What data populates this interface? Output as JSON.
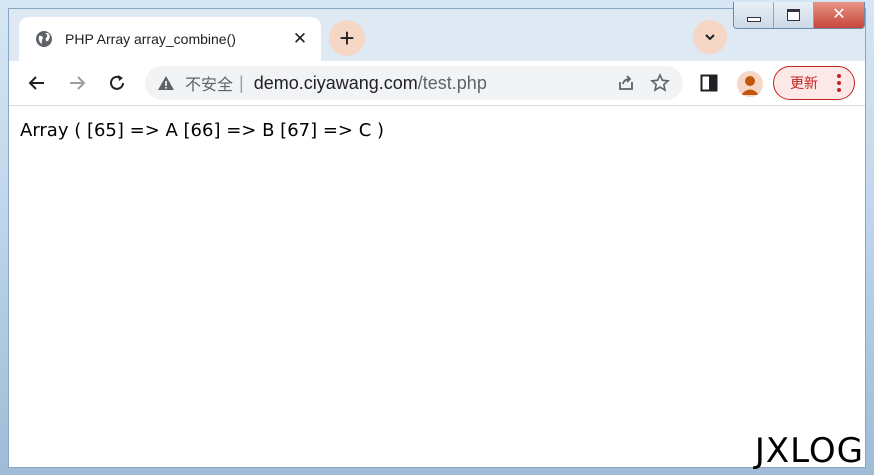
{
  "tab": {
    "title": "PHP Array array_combine()",
    "close_glyph": "✕",
    "icon": "globe-icon"
  },
  "newtab": {
    "glyph": "+"
  },
  "addressbar": {
    "security_label": "不安全",
    "separator": "|",
    "url_host": "demo.ciyawang.com",
    "url_path": "/test.php"
  },
  "update_button": {
    "label": "更新"
  },
  "page": {
    "output": "Array ( [65] => A [66] => B [67] => C )"
  },
  "watermark": "JXLOG",
  "colors": {
    "accent": "#f6d6c4",
    "update": "#c5221f",
    "background": "#c2d8ec"
  }
}
